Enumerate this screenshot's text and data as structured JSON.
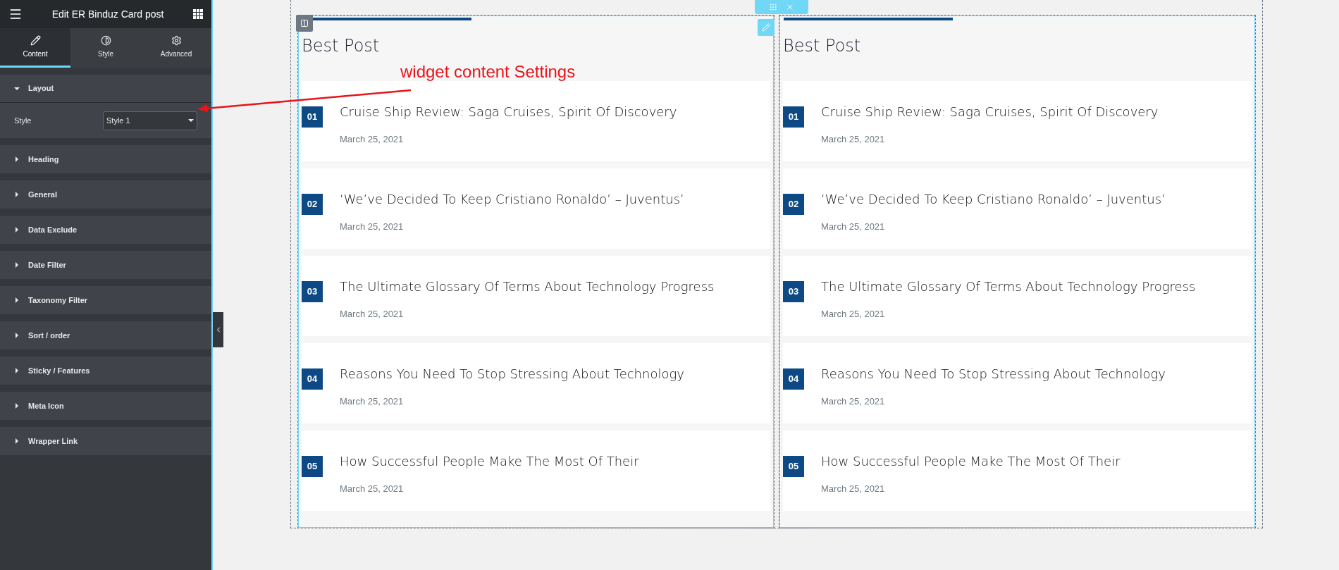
{
  "panel": {
    "title": "Edit ER Binduz Card post",
    "tabs": [
      {
        "label": "Content",
        "kind": "content",
        "selected": true
      },
      {
        "label": "Style",
        "kind": "style",
        "selected": false
      },
      {
        "label": "Advanced",
        "kind": "advanced",
        "selected": false
      }
    ],
    "sections": [
      {
        "label": "Layout",
        "expanded": true,
        "controls": [
          {
            "label": "Style",
            "value": "Style 1"
          }
        ]
      },
      {
        "label": "Heading",
        "expanded": false
      },
      {
        "label": "General",
        "expanded": false
      },
      {
        "label": "Data Exclude",
        "expanded": false
      },
      {
        "label": "Date Filter",
        "expanded": false
      },
      {
        "label": "Taxonomy Filter",
        "expanded": false
      },
      {
        "label": "Sort / order",
        "expanded": false
      },
      {
        "label": "Sticky / Features",
        "expanded": false
      },
      {
        "label": "Meta Icon",
        "expanded": false
      },
      {
        "label": "Wrapper Link",
        "expanded": false
      }
    ]
  },
  "annotation": {
    "text": "widget content Settings"
  },
  "columns": [
    {
      "heading": "Best Post",
      "posts": [
        {
          "number": "01",
          "title": "Cruise Ship Review: Saga Cruises, Spirit Of Discovery",
          "date": "March 25, 2021"
        },
        {
          "number": "02",
          "title": "‘We’ve Decided To Keep Cristiano Ronaldo’ – Juventus’",
          "date": "March 25, 2021"
        },
        {
          "number": "03",
          "title": "The Ultimate Glossary Of Terms About Technology Progress",
          "date": "March 25, 2021"
        },
        {
          "number": "04",
          "title": "Reasons You Need To Stop Stressing About Technology",
          "date": "March 25, 2021"
        },
        {
          "number": "05",
          "title": "How Successful People Make The Most Of Their",
          "date": "March 25, 2021"
        }
      ]
    },
    {
      "heading": "Best Post",
      "posts": [
        {
          "number": "01",
          "title": "Cruise Ship Review: Saga Cruises, Spirit Of Discovery",
          "date": "March 25, 2021"
        },
        {
          "number": "02",
          "title": "‘We’ve Decided To Keep Cristiano Ronaldo’ – Juventus’",
          "date": "March 25, 2021"
        },
        {
          "number": "03",
          "title": "The Ultimate Glossary Of Terms About Technology Progress",
          "date": "March 25, 2021"
        },
        {
          "number": "04",
          "title": "Reasons You Need To Stop Stressing About Technology",
          "date": "March 25, 2021"
        },
        {
          "number": "05",
          "title": "How Successful People Make The Most Of Their",
          "date": "March 25, 2021"
        }
      ]
    }
  ]
}
